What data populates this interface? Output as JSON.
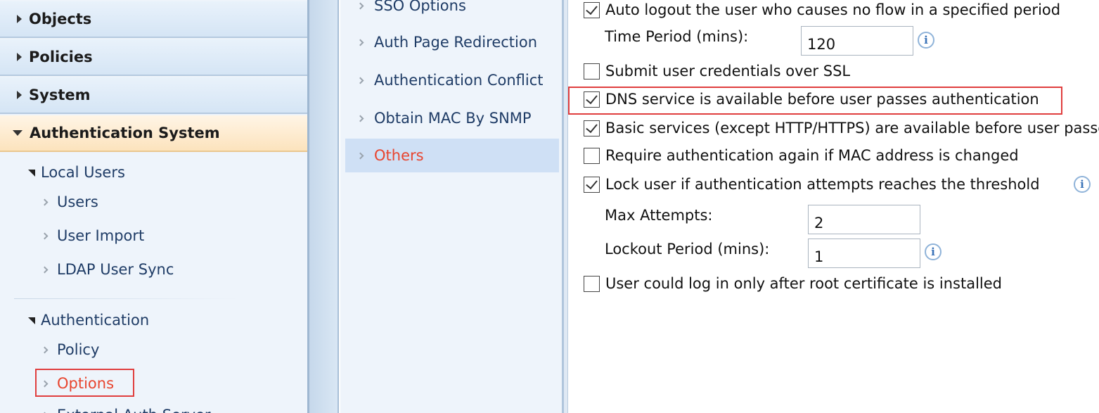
{
  "nav": {
    "sections": [
      {
        "label": "Objects"
      },
      {
        "label": "Policies"
      },
      {
        "label": "System"
      },
      {
        "label": "Authentication System"
      }
    ],
    "local_users": {
      "label": "Local Users",
      "items": [
        "Users",
        "User Import",
        "LDAP User Sync"
      ]
    },
    "authentication": {
      "label": "Authentication",
      "items": [
        "Policy",
        "Options",
        "External Auth Server"
      ]
    }
  },
  "submenu": {
    "items": [
      "SSO Options",
      "Auth Page Redirection",
      "Authentication Conflict",
      "Obtain MAC By SNMP",
      "Others"
    ],
    "active": "Others"
  },
  "content": {
    "auto_logout": {
      "label": "Auto logout the user who causes no flow in a specified period",
      "checked": true
    },
    "time_period": {
      "label": "Time Period (mins):",
      "value": "120"
    },
    "submit_ssl": {
      "label": "Submit user credentials over SSL",
      "checked": false
    },
    "dns_service": {
      "label": "DNS service is available before user passes authentication",
      "checked": true
    },
    "basic_services": {
      "label": "Basic services (except HTTP/HTTPS) are available before user passes authentication",
      "checked": true
    },
    "require_auth": {
      "label": "Require authentication again if MAC address is changed",
      "checked": false
    },
    "lock_user": {
      "label": "Lock user if authentication attempts reaches the threshold",
      "checked": true
    },
    "max_attempts": {
      "label": "Max Attempts:",
      "value": "2"
    },
    "lockout_period": {
      "label": "Lockout Period (mins):",
      "value": "1"
    },
    "root_cert": {
      "label": "User could log in only after root certificate is installed",
      "checked": false
    }
  },
  "icons": {
    "info": "i"
  },
  "colors": {
    "highlight": "#e03e3e",
    "active_text": "#e8452f",
    "link_text": "#1f3c66"
  }
}
